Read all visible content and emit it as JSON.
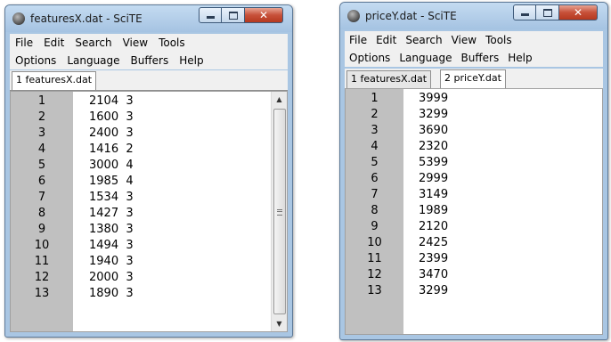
{
  "windows": [
    {
      "title": "featuresX.dat - SciTE",
      "menu_row1": [
        "File",
        "Edit",
        "Search",
        "View",
        "Tools"
      ],
      "menu_row2": [
        "Options",
        "Language",
        "Buffers",
        "Help"
      ],
      "tabs": [
        {
          "label": "1 featuresX.dat",
          "active": true
        }
      ],
      "lines": [
        {
          "n": "1",
          "text": "2104  3"
        },
        {
          "n": "2",
          "text": "1600  3"
        },
        {
          "n": "3",
          "text": "2400  3"
        },
        {
          "n": "4",
          "text": "1416  2"
        },
        {
          "n": "5",
          "text": "3000  4"
        },
        {
          "n": "6",
          "text": "1985  4"
        },
        {
          "n": "7",
          "text": "1534  3"
        },
        {
          "n": "8",
          "text": "1427  3"
        },
        {
          "n": "9",
          "text": "1380  3"
        },
        {
          "n": "10",
          "text": "1494  3"
        },
        {
          "n": "11",
          "text": "1940  3"
        },
        {
          "n": "12",
          "text": "2000  3"
        },
        {
          "n": "13",
          "text": "1890  3"
        }
      ]
    },
    {
      "title": "priceY.dat - SciTE",
      "menu_row1": [
        "File",
        "Edit",
        "Search",
        "View",
        "Tools"
      ],
      "menu_row2": [
        "Options",
        "Language",
        "Buffers",
        "Help"
      ],
      "tabs": [
        {
          "label": "1 featuresX.dat",
          "active": false
        },
        {
          "label": "2 priceY.dat",
          "active": true
        }
      ],
      "lines": [
        {
          "n": "1",
          "text": "3999"
        },
        {
          "n": "2",
          "text": "3299"
        },
        {
          "n": "3",
          "text": "3690"
        },
        {
          "n": "4",
          "text": "2320"
        },
        {
          "n": "5",
          "text": "5399"
        },
        {
          "n": "6",
          "text": "2999"
        },
        {
          "n": "7",
          "text": "3149"
        },
        {
          "n": "8",
          "text": "1989"
        },
        {
          "n": "9",
          "text": "2120"
        },
        {
          "n": "10",
          "text": "2425"
        },
        {
          "n": "11",
          "text": "2399"
        },
        {
          "n": "12",
          "text": "3470"
        },
        {
          "n": "13",
          "text": "3299"
        }
      ]
    }
  ]
}
